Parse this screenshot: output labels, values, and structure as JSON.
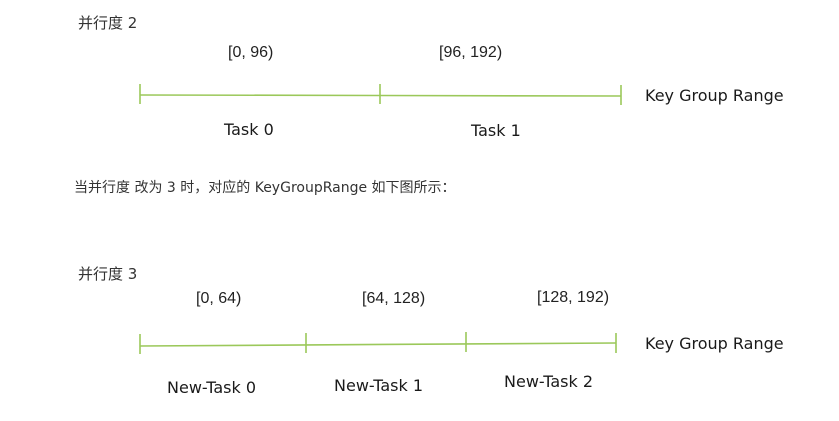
{
  "diagram1": {
    "title": "并行度 2",
    "ranges": [
      "[0, 96)",
      "[96, 192)"
    ],
    "tasks": [
      "Task 0",
      "Task 1"
    ],
    "axis_label": "Key Group Range"
  },
  "caption": "当并行度 改为 3 时，对应的 KeyGroupRange 如下图所示：",
  "diagram2": {
    "title": "并行度 3",
    "ranges": [
      "[0, 64)",
      "[64, 128)",
      "[128, 192)"
    ],
    "tasks": [
      "New-Task 0",
      "New-Task 1",
      "New-Task 2"
    ],
    "axis_label": "Key Group Range"
  },
  "colors": {
    "line": "#9bc85a"
  }
}
